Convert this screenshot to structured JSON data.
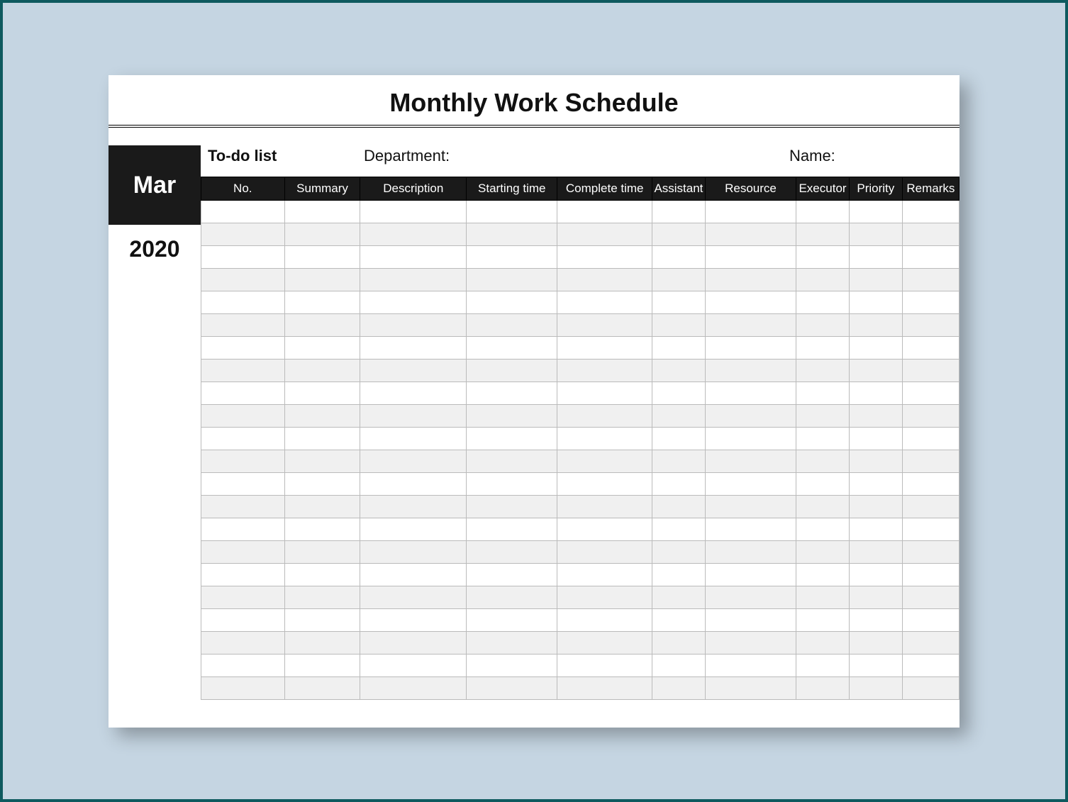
{
  "title": "Monthly Work Schedule",
  "month": "Mar",
  "year": "2020",
  "meta": {
    "todo_label": "To-do list",
    "department_label": "Department:",
    "name_label": "Name:"
  },
  "columns": [
    "No.",
    "Summary",
    "Description",
    "Starting time",
    "Complete time",
    "Assistant",
    "Resource",
    "Executor",
    "Priority",
    "Remarks"
  ],
  "row_count": 22
}
